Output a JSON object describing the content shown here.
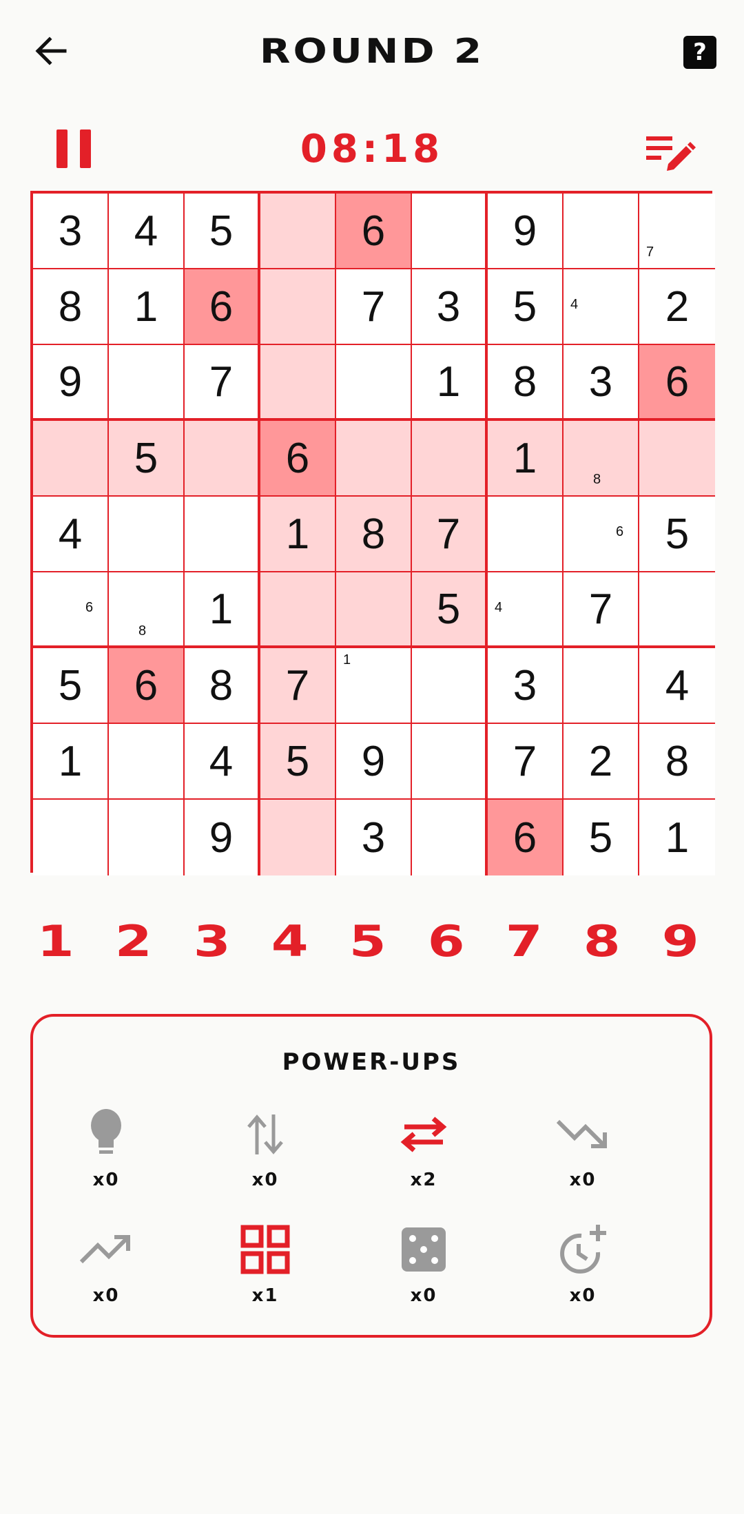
{
  "header": {
    "title": "ROUND 2",
    "help_label": "?"
  },
  "controls": {
    "timer": "08:18"
  },
  "colors": {
    "accent": "#e32028",
    "highlight": "#ffd5d6",
    "match": "#ff9799",
    "disabled": "#9a9a9a"
  },
  "board": {
    "values": [
      [
        "3",
        "4",
        "5",
        "",
        "6",
        "",
        "9",
        "",
        ""
      ],
      [
        "8",
        "1",
        "6",
        "",
        "7",
        "3",
        "5",
        "",
        "2"
      ],
      [
        "9",
        "",
        "7",
        "",
        "",
        "1",
        "8",
        "3",
        "6"
      ],
      [
        "",
        "5",
        "",
        "6",
        "",
        "",
        "1",
        "",
        ""
      ],
      [
        "4",
        "",
        "",
        "1",
        "8",
        "7",
        "",
        "",
        "5"
      ],
      [
        "",
        "",
        "1",
        "",
        "",
        "5",
        "",
        "7",
        ""
      ],
      [
        "5",
        "6",
        "8",
        "7",
        "",
        "",
        "3",
        "",
        "4"
      ],
      [
        "1",
        "",
        "4",
        "5",
        "9",
        "",
        "7",
        "2",
        "8"
      ],
      [
        "",
        "",
        "9",
        "",
        "3",
        "",
        "6",
        "5",
        "1"
      ]
    ],
    "notes": [
      {
        "row": 0,
        "col": 8,
        "digit": "7"
      },
      {
        "row": 1,
        "col": 7,
        "digit": "4"
      },
      {
        "row": 3,
        "col": 7,
        "digit": "8"
      },
      {
        "row": 4,
        "col": 7,
        "digit": "6"
      },
      {
        "row": 5,
        "col": 0,
        "digit": "6"
      },
      {
        "row": 5,
        "col": 1,
        "digit": "8"
      },
      {
        "row": 5,
        "col": 6,
        "digit": "4"
      },
      {
        "row": 6,
        "col": 4,
        "digit": "1"
      }
    ],
    "selected_row": 3,
    "selected_col": 3,
    "highlight_digit": "6"
  },
  "numpad": [
    "1",
    "2",
    "3",
    "4",
    "5",
    "6",
    "7",
    "8",
    "9"
  ],
  "powerups": {
    "title": "POWER-UPS",
    "items": [
      {
        "icon": "lightbulb-icon",
        "count": "x0",
        "active": false
      },
      {
        "icon": "swap-vertical-icon",
        "count": "x0",
        "active": false
      },
      {
        "icon": "swap-horizontal-icon",
        "count": "x2",
        "active": true
      },
      {
        "icon": "trending-down-icon",
        "count": "x0",
        "active": false
      },
      {
        "icon": "trending-up-icon",
        "count": "x0",
        "active": false
      },
      {
        "icon": "grid-icon",
        "count": "x1",
        "active": true
      },
      {
        "icon": "dice-icon",
        "count": "x0",
        "active": false
      },
      {
        "icon": "add-time-icon",
        "count": "x0",
        "active": false
      }
    ]
  }
}
